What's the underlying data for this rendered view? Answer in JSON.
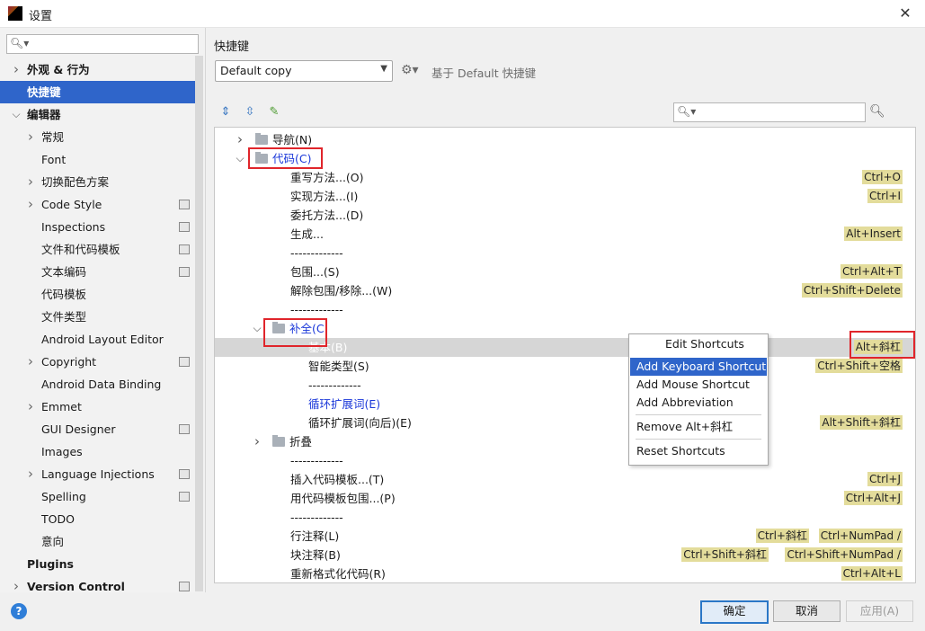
{
  "window": {
    "title": "设置",
    "app_icon": "IJ"
  },
  "sidebar": {
    "search_placeholder": "",
    "items": [
      {
        "label": "外观 & 行为",
        "expander": "collapsed",
        "bold": true
      },
      {
        "label": "快捷键",
        "selected": true,
        "bold": true
      },
      {
        "label": "编辑器",
        "expander": "expanded",
        "bold": true
      },
      {
        "label": "常规",
        "expander": "collapsed"
      },
      {
        "label": "Font"
      },
      {
        "label": "切换配色方案",
        "expander": "collapsed"
      },
      {
        "label": "Code Style",
        "expander": "collapsed",
        "project": true
      },
      {
        "label": "Inspections",
        "project": true
      },
      {
        "label": "文件和代码模板",
        "project": true
      },
      {
        "label": "文本编码",
        "project": true
      },
      {
        "label": "代码模板"
      },
      {
        "label": "文件类型"
      },
      {
        "label": "Android Layout Editor"
      },
      {
        "label": "Copyright",
        "expander": "collapsed",
        "project": true
      },
      {
        "label": "Android Data Binding"
      },
      {
        "label": "Emmet",
        "expander": "collapsed"
      },
      {
        "label": "GUI Designer",
        "project": true
      },
      {
        "label": "Images"
      },
      {
        "label": "Language Injections",
        "expander": "collapsed",
        "project": true
      },
      {
        "label": "Spelling",
        "project": true
      },
      {
        "label": "TODO"
      },
      {
        "label": "意向"
      },
      {
        "label": "Plugins",
        "bold": true
      },
      {
        "label": "Version Control",
        "expander": "collapsed",
        "bold": true,
        "project": true
      }
    ]
  },
  "main": {
    "title": "快捷键",
    "keymap": "Default copy",
    "based_on": "基于 Default 快捷键",
    "filter_placeholder": ""
  },
  "tree": [
    {
      "label": "导航(N)",
      "expander": "collapsed",
      "folder": true,
      "shortcuts": []
    },
    {
      "label": "代码(C)",
      "expander": "expanded",
      "folder": true,
      "blue": true,
      "shortcuts": []
    },
    {
      "label": "重写方法...(O)",
      "shortcuts": [
        "Ctrl+O"
      ]
    },
    {
      "label": "实现方法...(I)",
      "shortcuts": [
        "Ctrl+I"
      ]
    },
    {
      "label": "委托方法...(D)",
      "shortcuts": []
    },
    {
      "label": "生成...",
      "shortcuts": [
        "Alt+Insert"
      ]
    },
    {
      "label": "-------------",
      "shortcuts": []
    },
    {
      "label": "包围...(S)",
      "shortcuts": [
        "Ctrl+Alt+T"
      ]
    },
    {
      "label": "解除包围/移除...(W)",
      "shortcuts": [
        "Ctrl+Shift+Delete"
      ]
    },
    {
      "label": "-------------",
      "shortcuts": []
    },
    {
      "label": "补全(C",
      "expander": "expanded",
      "folder": true,
      "blue": true,
      "shortcuts": []
    },
    {
      "label": "基本(B)",
      "highlighted": true,
      "shortcuts": [
        "Alt+斜杠"
      ]
    },
    {
      "label": "智能类型(S)",
      "shortcuts": [
        "Ctrl+Shift+空格"
      ]
    },
    {
      "label": "-------------",
      "shortcuts": []
    },
    {
      "label": "循环扩展词(E)",
      "blue": true,
      "shortcuts": []
    },
    {
      "label": "循环扩展词(向后)(E)",
      "shortcuts": [
        "Alt+Shift+斜杠"
      ]
    },
    {
      "label": "折叠",
      "expander": "collapsed",
      "folder": true,
      "shortcuts": []
    },
    {
      "label": "-------------",
      "shortcuts": []
    },
    {
      "label": "插入代码模板...(T)",
      "shortcuts": [
        "Ctrl+J"
      ]
    },
    {
      "label": "用代码模板包围...(P)",
      "shortcuts": [
        "Ctrl+Alt+J"
      ]
    },
    {
      "label": "-------------",
      "shortcuts": []
    },
    {
      "label": "行注释(L)",
      "shortcuts": [
        "Ctrl+斜杠",
        "Ctrl+NumPad /"
      ]
    },
    {
      "label": "块注释(B)",
      "shortcuts": [
        "Ctrl+Shift+斜杠",
        "Ctrl+Shift+NumPad /"
      ]
    },
    {
      "label": "重新格式化代码(R)",
      "shortcuts": [
        "Ctrl+Alt+L"
      ]
    }
  ],
  "context_menu": {
    "header": "Edit Shortcuts",
    "items": [
      "Add Keyboard Shortcut",
      "Add Mouse Shortcut",
      "Add Abbreviation",
      "Remove Alt+斜杠",
      "Reset Shortcuts"
    ],
    "selected": "Add Keyboard Shortcut"
  },
  "buttons": {
    "ok": "确定",
    "cancel": "取消",
    "apply": "应用(A)"
  },
  "colors": {
    "selection": "#2f65ca",
    "shortcut_bg": "#e3dc9b",
    "annotation": "#e0252b",
    "link_blue": "#1a37d9"
  }
}
